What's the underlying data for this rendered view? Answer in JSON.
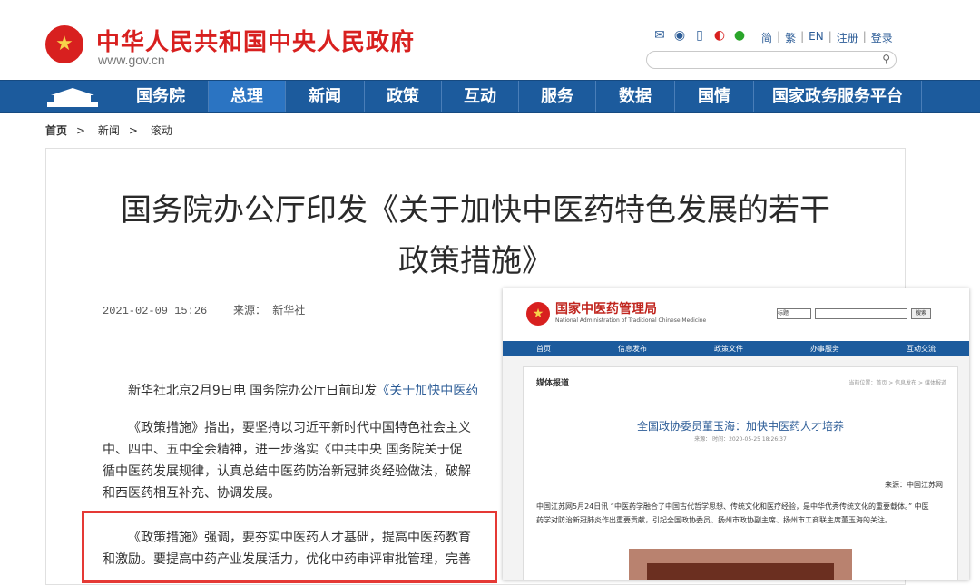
{
  "header": {
    "site_title": "中华人民共和国中央人民政府",
    "site_url": "www.gov.cn",
    "links": [
      "简",
      "繁",
      "EN",
      "注册",
      "登录"
    ]
  },
  "nav": {
    "items": [
      "国务院",
      "总理",
      "新闻",
      "政策",
      "互动",
      "服务",
      "数据",
      "国情",
      "国家政务服务平台"
    ],
    "active": "总理"
  },
  "breadcrumb": [
    "首页",
    "新闻",
    "滚动"
  ],
  "article": {
    "title_line1": "国务院办公厅印发《关于加快中医药特色发展的若干",
    "title_line2": "政策措施》",
    "date": "2021-02-09 15:26",
    "source_label": "来源：",
    "source": "新华社",
    "p1_start": "新华社北京2月9日电  国务院办公厅日前印发",
    "p1_link": "《关于加快中医药",
    "p2_line1": "《政策措施》指出，要坚持以习近平新时代中国特色社会主义",
    "p2_line2": "中、四中、五中全会精神，进一步落实《中共中央  国务院关于促",
    "p2_line3": "循中医药发展规律，认真总结中医药防治新冠肺炎经验做法，破解",
    "p2_line4": "和西医药相互补充、协调发展。",
    "p3_line1": "《政策措施》强调，要夯实中医药人才基础，提高中医药教育",
    "p3_line2": "和激励。要提高中药产业发展活力，优化中药审评审批管理，完善"
  },
  "overlay": {
    "org_name": "国家中医药管理局",
    "org_en": "National Administration of Traditional Chinese Medicine",
    "select": "标题",
    "search_btn": "搜索",
    "nav": [
      "首页",
      "信息发布",
      "政策文件",
      "办事服务",
      "互动交流"
    ],
    "section": "媒体报道",
    "crumb": "当前位置：首页 > 信息发布 > 媒体报道",
    "article_title": "全国政协委员董玉海：加快中医药人才培养",
    "article_meta": "来源：  时间：2020-05-25 18:26:37",
    "source": "来源：中国江苏网",
    "body": "中国江苏网5月24日讯 “中医药学融合了中国古代哲学思想、传统文化和医疗经验，是中华优秀传统文化的重要载体。” 中医药学对防治新冠肺炎作出重要贡献，引起全国政协委员、扬州市政协副主席、扬州市工商联主席董玉海的关注。"
  },
  "colors": {
    "brand_red": "#d8201f",
    "nav_blue": "#1c5b9d",
    "highlight_red": "#e53935"
  }
}
